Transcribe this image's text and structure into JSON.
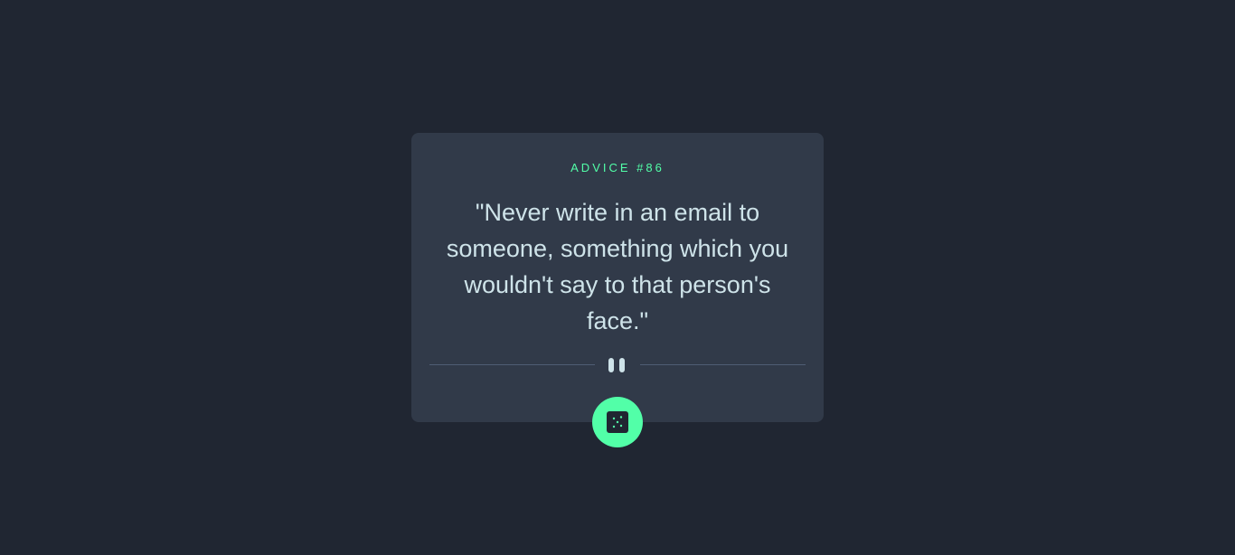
{
  "card": {
    "label": "ADVICE #86",
    "quote": "\"Never write in an email to someone, something which you wouldn't say to that person's face.\""
  },
  "divider": {
    "icon": "pause-icon"
  },
  "dice_button": {
    "icon": "dice-icon"
  },
  "colors": {
    "background": "#202632",
    "card": "#313a49",
    "accent": "#52ffa8",
    "text": "#cee3e9",
    "divider": "#4f5d74"
  }
}
